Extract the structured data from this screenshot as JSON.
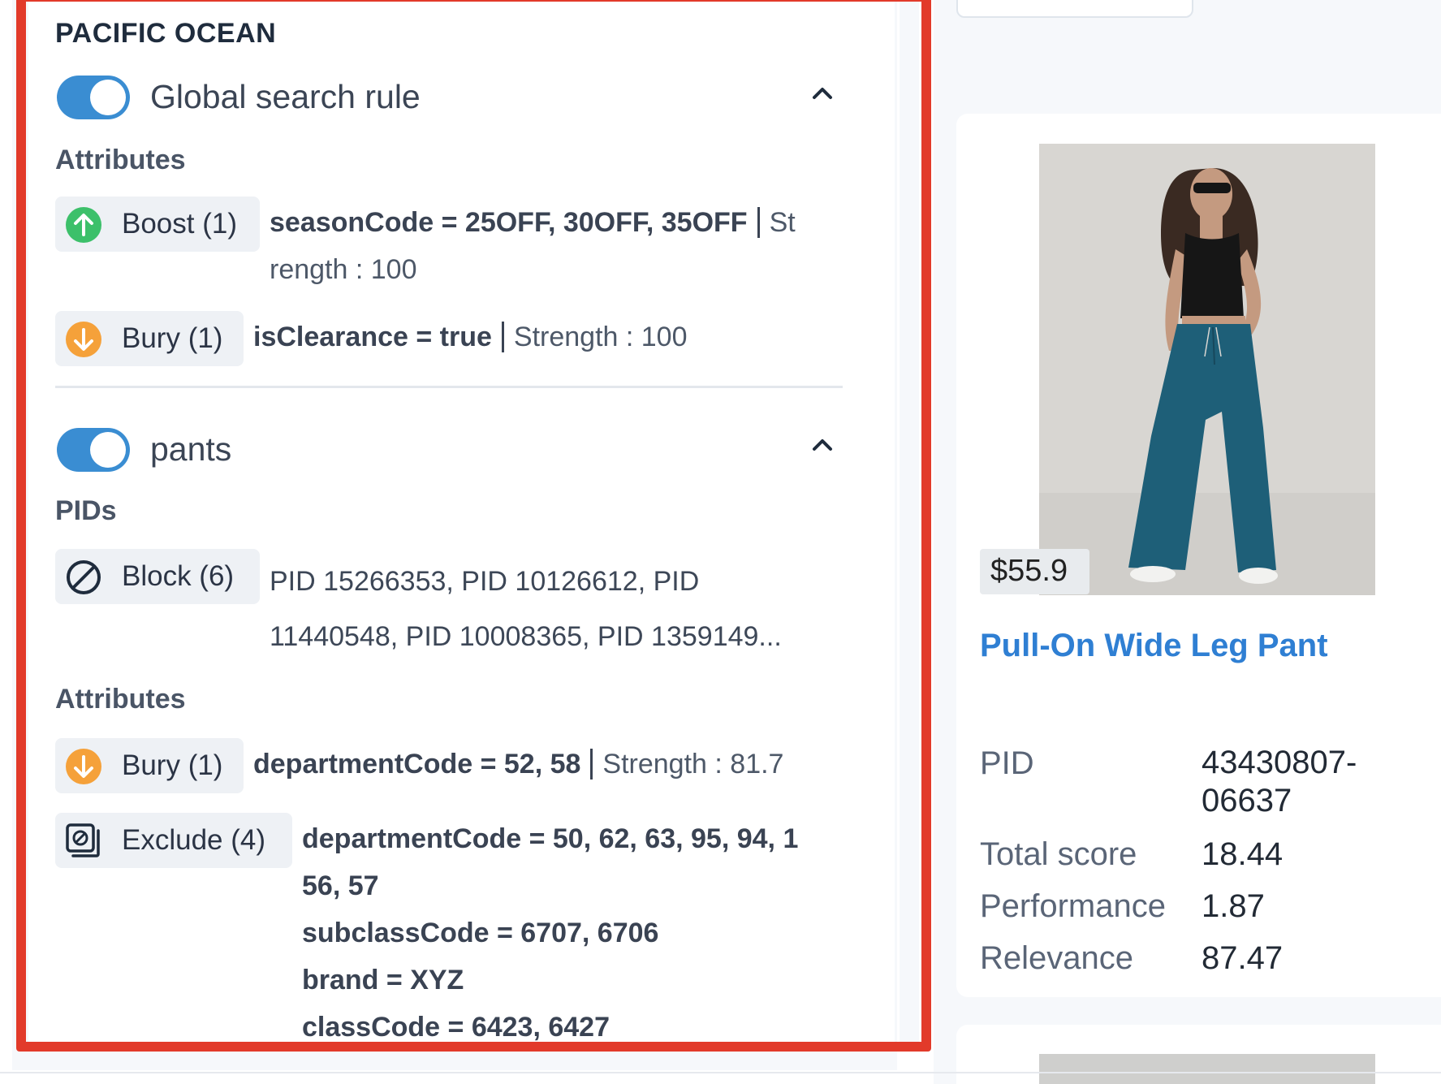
{
  "store": {
    "title": "PACIFIC OCEAN"
  },
  "rules": [
    {
      "name": "Global search rule",
      "enabled": true,
      "sections": [
        {
          "label": "Attributes",
          "items": [
            {
              "type": "Boost (1)",
              "icon": "boost-up-arrow-icon",
              "condition": "seasonCode = 25OFF, 30OFF, 35OFF",
              "strength_a": "St",
              "strength_b": "rength : 100"
            },
            {
              "type": "Bury (1)",
              "icon": "bury-down-arrow-icon",
              "condition": "isClearance = true",
              "strength": "Strength : 100"
            }
          ]
        }
      ]
    },
    {
      "name": "pants",
      "enabled": true,
      "sections": [
        {
          "label": "PIDs",
          "items": [
            {
              "type": "Block (6)",
              "icon": "block-icon",
              "line1": "PID 15266353, PID 10126612, PID",
              "line2": "11440548, PID 10008365, PID 1359149..."
            }
          ]
        },
        {
          "label": "Attributes",
          "items": [
            {
              "type": "Bury (1)",
              "icon": "bury-down-arrow-icon",
              "condition": "departmentCode = 52, 58",
              "strength": "Strength : 81.7"
            },
            {
              "type": "Exclude (4)",
              "icon": "exclude-icon",
              "lines": [
                "departmentCode = 50, 62, 63, 95, 94, 1",
                "56, 57",
                "subclassCode = 6707, 6706",
                "brand = XYZ",
                "classCode = 6423, 6427"
              ]
            }
          ]
        }
      ]
    }
  ],
  "product": {
    "price": "$55.9",
    "title": "Pull-On Wide Leg Pant",
    "details": [
      {
        "key": "PID",
        "value_line1": "43430807-",
        "value_line2": "06637"
      },
      {
        "key": "Total score",
        "value": "18.44"
      },
      {
        "key": "Performance",
        "value": "1.87"
      },
      {
        "key": "Relevance",
        "value": "87.47"
      }
    ]
  },
  "colors": {
    "toggle": "#3a8dd2",
    "boost": "#3cc06a",
    "bury": "#f5a13a",
    "link": "#2f7fd3",
    "highlight_frame": "#e23a2a"
  }
}
